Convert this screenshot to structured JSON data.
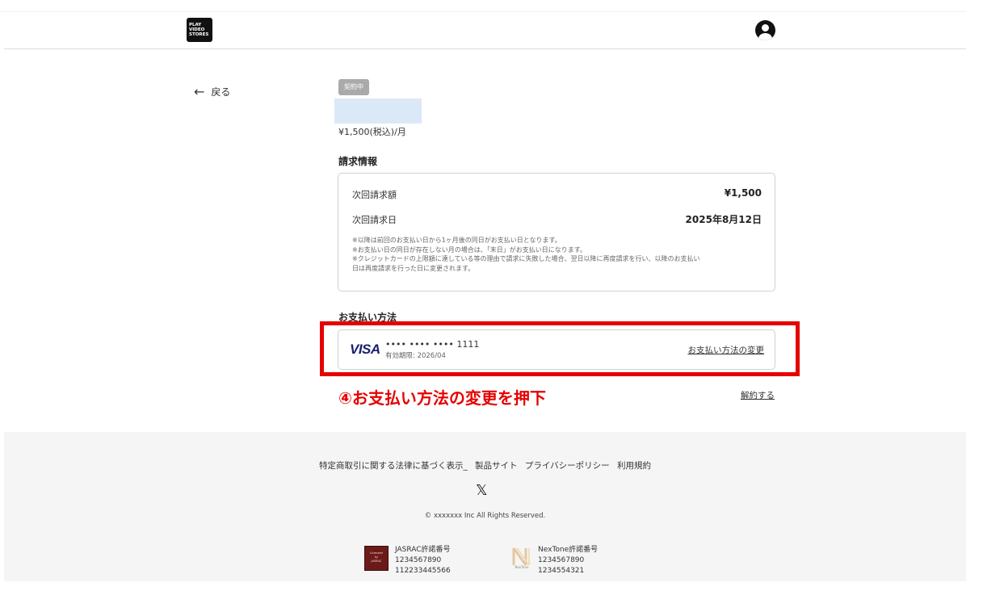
{
  "header": {
    "logo_lines": [
      "PLAY",
      "VIDEO",
      "STORES"
    ]
  },
  "back": {
    "label": "戻る"
  },
  "plan": {
    "status_badge": "契約中",
    "price": "¥1,500(税込)/月"
  },
  "billing": {
    "title": "請求情報",
    "next_amount_label": "次回請求額",
    "next_amount_value": "¥1,500",
    "next_date_label": "次回請求日",
    "next_date_value": "2025年8月12日",
    "notes": [
      "※以降は前回のお支払い日から1ヶ月後の同日がお支払い日となります。",
      "※お支払い日の同日が存在しない月の場合は、「末日」がお支払い日になります。",
      "※クレジットカードの上限額に達している等の理由で請求に失敗した場合、翌日以降に再度請求を行い、以降のお支払い",
      "日は再度請求を行った日に変更されます。"
    ]
  },
  "payment": {
    "title": "お支払い方法",
    "brand": "VISA",
    "card_number": "•••• •••• •••• 1111",
    "expiry": "有効期限: 2026/04",
    "change_label": "お支払い方法の変更"
  },
  "annotation": {
    "instruction": "④お支払い方法の変更を押下",
    "color": "#e60000"
  },
  "cancel_label": "解約する",
  "footer": {
    "links": [
      "特定商取引に関する法律に基づく表示_",
      "製品サイト",
      "プライバシーポリシー",
      "利用規約"
    ],
    "social_icon": "x-icon",
    "copyright": "© xxxxxxx Inc All Rights Reserved.",
    "jasrac": {
      "logo_lines": [
        "Licensed",
        "by",
        "JASRAC"
      ],
      "title": "JASRAC許諾番号",
      "number1": "1234567890",
      "number2": "112233445566"
    },
    "nextone": {
      "logo_caption": "NexTone",
      "title": "NexTone許諾番号",
      "number1": "1234567890",
      "number2": "1234554321"
    }
  }
}
